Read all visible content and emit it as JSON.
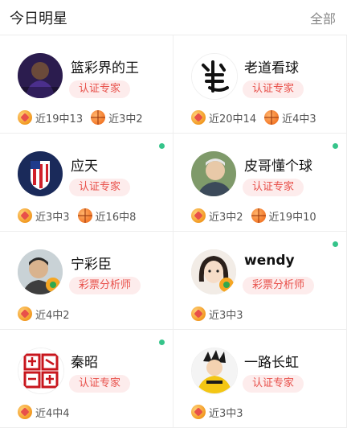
{
  "header": {
    "title": "今日明星",
    "more": "全部"
  },
  "colors": {
    "badge_bg": "#fdecec",
    "badge_text": "#e8504a",
    "online_dot": "#35c48a"
  },
  "experts": [
    {
      "name": "篮彩界的王",
      "badge": "认证专家",
      "online": false,
      "stats": [
        {
          "icon": "football-icon",
          "text": "近19中13"
        },
        {
          "icon": "basketball-icon",
          "text": "近3中2"
        }
      ]
    },
    {
      "name": "老道看球",
      "badge": "认证专家",
      "online": false,
      "stats": [
        {
          "icon": "football-icon",
          "text": "近20中14"
        },
        {
          "icon": "basketball-icon",
          "text": "近4中3"
        }
      ]
    },
    {
      "name": "应天",
      "badge": "认证专家",
      "online": true,
      "stats": [
        {
          "icon": "football-icon",
          "text": "近3中3"
        },
        {
          "icon": "basketball-icon",
          "text": "近16中8"
        }
      ]
    },
    {
      "name": "皮哥懂个球",
      "badge": "认证专家",
      "online": true,
      "stats": [
        {
          "icon": "football-icon",
          "text": "近3中2"
        },
        {
          "icon": "basketball-icon",
          "text": "近19中10"
        }
      ]
    },
    {
      "name": "宁彩臣",
      "badge": "彩票分析师",
      "online": false,
      "stats": [
        {
          "icon": "football-icon",
          "text": "近4中2"
        }
      ]
    },
    {
      "name": "wendy",
      "badge": "彩票分析师",
      "online": true,
      "stats": [
        {
          "icon": "football-icon",
          "text": "近3中3"
        }
      ]
    },
    {
      "name": "秦昭",
      "badge": "认证专家",
      "online": true,
      "stats": [
        {
          "icon": "football-icon",
          "text": "近4中4"
        }
      ]
    },
    {
      "name": "一路长虹",
      "badge": "认证专家",
      "online": false,
      "stats": [
        {
          "icon": "football-icon",
          "text": "近3中3"
        }
      ]
    }
  ]
}
